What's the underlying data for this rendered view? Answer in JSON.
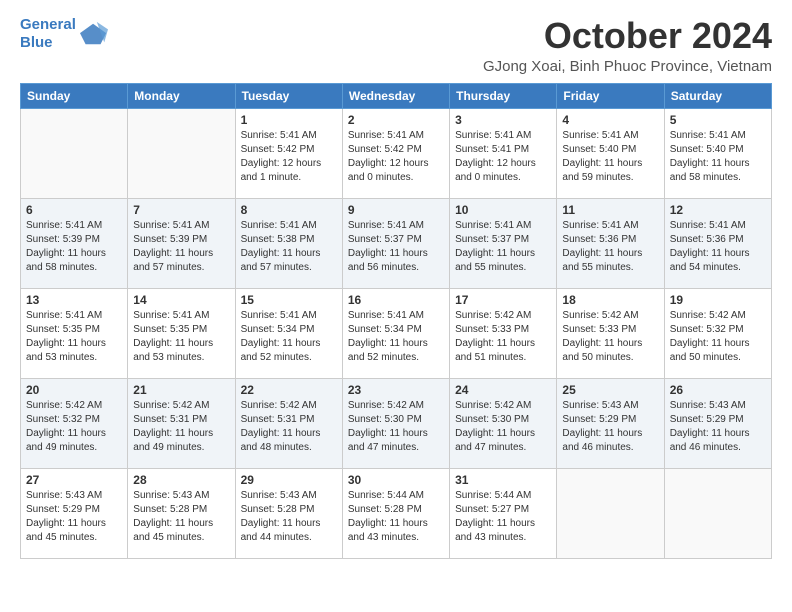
{
  "header": {
    "logo_line1": "General",
    "logo_line2": "Blue",
    "month_title": "October 2024",
    "subtitle": "GJong Xoai, Binh Phuoc Province, Vietnam"
  },
  "days_of_week": [
    "Sunday",
    "Monday",
    "Tuesday",
    "Wednesday",
    "Thursday",
    "Friday",
    "Saturday"
  ],
  "weeks": [
    [
      {
        "day": "",
        "info": ""
      },
      {
        "day": "",
        "info": ""
      },
      {
        "day": "1",
        "info": "Sunrise: 5:41 AM\nSunset: 5:42 PM\nDaylight: 12 hours and 1 minute."
      },
      {
        "day": "2",
        "info": "Sunrise: 5:41 AM\nSunset: 5:42 PM\nDaylight: 12 hours and 0 minutes."
      },
      {
        "day": "3",
        "info": "Sunrise: 5:41 AM\nSunset: 5:41 PM\nDaylight: 12 hours and 0 minutes."
      },
      {
        "day": "4",
        "info": "Sunrise: 5:41 AM\nSunset: 5:40 PM\nDaylight: 11 hours and 59 minutes."
      },
      {
        "day": "5",
        "info": "Sunrise: 5:41 AM\nSunset: 5:40 PM\nDaylight: 11 hours and 58 minutes."
      }
    ],
    [
      {
        "day": "6",
        "info": "Sunrise: 5:41 AM\nSunset: 5:39 PM\nDaylight: 11 hours and 58 minutes."
      },
      {
        "day": "7",
        "info": "Sunrise: 5:41 AM\nSunset: 5:39 PM\nDaylight: 11 hours and 57 minutes."
      },
      {
        "day": "8",
        "info": "Sunrise: 5:41 AM\nSunset: 5:38 PM\nDaylight: 11 hours and 57 minutes."
      },
      {
        "day": "9",
        "info": "Sunrise: 5:41 AM\nSunset: 5:37 PM\nDaylight: 11 hours and 56 minutes."
      },
      {
        "day": "10",
        "info": "Sunrise: 5:41 AM\nSunset: 5:37 PM\nDaylight: 11 hours and 55 minutes."
      },
      {
        "day": "11",
        "info": "Sunrise: 5:41 AM\nSunset: 5:36 PM\nDaylight: 11 hours and 55 minutes."
      },
      {
        "day": "12",
        "info": "Sunrise: 5:41 AM\nSunset: 5:36 PM\nDaylight: 11 hours and 54 minutes."
      }
    ],
    [
      {
        "day": "13",
        "info": "Sunrise: 5:41 AM\nSunset: 5:35 PM\nDaylight: 11 hours and 53 minutes."
      },
      {
        "day": "14",
        "info": "Sunrise: 5:41 AM\nSunset: 5:35 PM\nDaylight: 11 hours and 53 minutes."
      },
      {
        "day": "15",
        "info": "Sunrise: 5:41 AM\nSunset: 5:34 PM\nDaylight: 11 hours and 52 minutes."
      },
      {
        "day": "16",
        "info": "Sunrise: 5:41 AM\nSunset: 5:34 PM\nDaylight: 11 hours and 52 minutes."
      },
      {
        "day": "17",
        "info": "Sunrise: 5:42 AM\nSunset: 5:33 PM\nDaylight: 11 hours and 51 minutes."
      },
      {
        "day": "18",
        "info": "Sunrise: 5:42 AM\nSunset: 5:33 PM\nDaylight: 11 hours and 50 minutes."
      },
      {
        "day": "19",
        "info": "Sunrise: 5:42 AM\nSunset: 5:32 PM\nDaylight: 11 hours and 50 minutes."
      }
    ],
    [
      {
        "day": "20",
        "info": "Sunrise: 5:42 AM\nSunset: 5:32 PM\nDaylight: 11 hours and 49 minutes."
      },
      {
        "day": "21",
        "info": "Sunrise: 5:42 AM\nSunset: 5:31 PM\nDaylight: 11 hours and 49 minutes."
      },
      {
        "day": "22",
        "info": "Sunrise: 5:42 AM\nSunset: 5:31 PM\nDaylight: 11 hours and 48 minutes."
      },
      {
        "day": "23",
        "info": "Sunrise: 5:42 AM\nSunset: 5:30 PM\nDaylight: 11 hours and 47 minutes."
      },
      {
        "day": "24",
        "info": "Sunrise: 5:42 AM\nSunset: 5:30 PM\nDaylight: 11 hours and 47 minutes."
      },
      {
        "day": "25",
        "info": "Sunrise: 5:43 AM\nSunset: 5:29 PM\nDaylight: 11 hours and 46 minutes."
      },
      {
        "day": "26",
        "info": "Sunrise: 5:43 AM\nSunset: 5:29 PM\nDaylight: 11 hours and 46 minutes."
      }
    ],
    [
      {
        "day": "27",
        "info": "Sunrise: 5:43 AM\nSunset: 5:29 PM\nDaylight: 11 hours and 45 minutes."
      },
      {
        "day": "28",
        "info": "Sunrise: 5:43 AM\nSunset: 5:28 PM\nDaylight: 11 hours and 45 minutes."
      },
      {
        "day": "29",
        "info": "Sunrise: 5:43 AM\nSunset: 5:28 PM\nDaylight: 11 hours and 44 minutes."
      },
      {
        "day": "30",
        "info": "Sunrise: 5:44 AM\nSunset: 5:28 PM\nDaylight: 11 hours and 43 minutes."
      },
      {
        "day": "31",
        "info": "Sunrise: 5:44 AM\nSunset: 5:27 PM\nDaylight: 11 hours and 43 minutes."
      },
      {
        "day": "",
        "info": ""
      },
      {
        "day": "",
        "info": ""
      }
    ]
  ]
}
